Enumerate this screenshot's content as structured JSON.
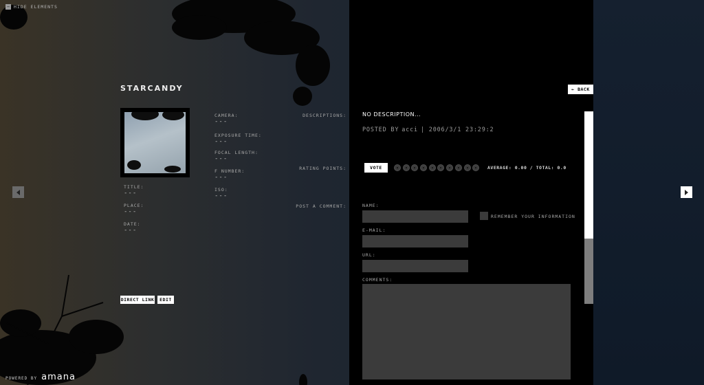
{
  "toolbar": {
    "hide_elements": "HIDE ELEMENTS"
  },
  "photo": {
    "title": "STARCANDY"
  },
  "meta_left": [
    {
      "label": "TITLE:",
      "value": "---"
    },
    {
      "label": "PLACE:",
      "value": "---"
    },
    {
      "label": "DATE:",
      "value": "---"
    }
  ],
  "meta_exif": [
    {
      "label": "CAMERA:",
      "value": "---"
    },
    {
      "label": "EXPOSURE TIME:",
      "value": "---"
    },
    {
      "label": "FOCAL LENGTH:",
      "value": "---"
    },
    {
      "label": "F NUMBER:",
      "value": "---"
    },
    {
      "label": "ISO:",
      "value": "---"
    }
  ],
  "buttons": {
    "back": "← BACK",
    "direct_link": "DIRECT LINK",
    "edit": "EDIT",
    "vote": "VOTE"
  },
  "description": {
    "label": "DESCRIPTIONS:",
    "text": "NO DESCRIPTION...",
    "posted_by_label": "POSTED BY",
    "author": "acci",
    "date": "| 2006/3/1 23:29:2"
  },
  "rating": {
    "label": "RATING POINTS:",
    "dot_count": 10,
    "average_text": "AVERAGE: 0.00 / TOTAL: 0.0"
  },
  "comment_form": {
    "label": "POST A COMMENT:",
    "name_label": "NAME:",
    "email_label": "E-MAIL:",
    "url_label": "URL:",
    "comments_label": "COMMENTS:",
    "remember_label": "REMEMBER YOUR INFORMATION",
    "name_value": "",
    "email_value": "",
    "url_value": "",
    "comments_value": ""
  },
  "footer": {
    "powered_by": "POWERED BY",
    "brand": "amana"
  },
  "icons": {
    "prev": "arrow-left-icon",
    "next": "arrow-right-icon",
    "hide": "minus-box-icon"
  },
  "colors": {
    "panel": "#000000",
    "field": "#3b3b3b",
    "button": "#ffffff"
  }
}
